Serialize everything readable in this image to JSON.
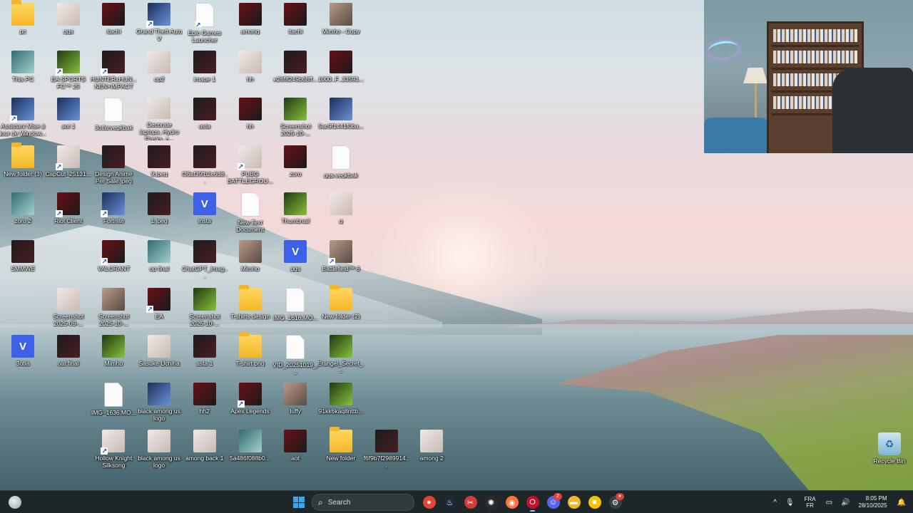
{
  "desktop": {
    "icons": [
      {
        "label": "pc",
        "kind": "folder",
        "col": 0,
        "row": 0
      },
      {
        "label": "ggs",
        "kind": "img-light",
        "col": 1,
        "row": 0
      },
      {
        "label": "itachi",
        "kind": "img-red",
        "col": 2,
        "row": 0
      },
      {
        "label": "Grand Theft Auto V",
        "kind": "img-blue",
        "col": 3,
        "row": 0,
        "shortcut": true
      },
      {
        "label": "Epic Games Launcher",
        "kind": "doc",
        "col": 4,
        "row": 0,
        "shortcut": true
      },
      {
        "label": "among",
        "kind": "img-red",
        "col": 5,
        "row": 0
      },
      {
        "label": "itachi",
        "kind": "img-red",
        "col": 6,
        "row": 0
      },
      {
        "label": "Mimho - Copy",
        "kind": "img-photo",
        "col": 7,
        "row": 0
      },
      {
        "label": "This PC",
        "kind": "img-teal",
        "col": 0,
        "row": 1
      },
      {
        "label": "EA SPORTS FC™ 25",
        "kind": "img-green",
        "col": 1,
        "row": 1,
        "shortcut": true
      },
      {
        "label": "HUNTERxHUN... NEN×IMPACT",
        "kind": "img-dark",
        "col": 2,
        "row": 1,
        "shortcut": true
      },
      {
        "label": "op2",
        "kind": "img-light",
        "col": 3,
        "row": 1
      },
      {
        "label": "image 1",
        "kind": "img-dark",
        "col": 4,
        "row": 1
      },
      {
        "label": "hh",
        "kind": "img-light",
        "col": 5,
        "row": 1
      },
      {
        "label": "e26f8249b68ff...",
        "kind": "img-dark",
        "col": 6,
        "row": 1
      },
      {
        "label": "1000_F_33591...",
        "kind": "img-red",
        "col": 7,
        "row": 1
      },
      {
        "label": "Assistant Mise à jour de Window...",
        "kind": "img-blue",
        "col": 0,
        "row": 2,
        "shortcut": true
      },
      {
        "label": "aot 1",
        "kind": "img-blue",
        "col": 1,
        "row": 2
      },
      {
        "label": "3otlarvegkbak",
        "kind": "doc",
        "col": 2,
        "row": 2
      },
      {
        "label": "Decorate laptops, Hydro Flasks, c...",
        "kind": "img-light",
        "col": 3,
        "row": 2
      },
      {
        "label": "asta",
        "kind": "img-dark",
        "col": 4,
        "row": 2
      },
      {
        "label": "hh",
        "kind": "img-red",
        "col": 5,
        "row": 2
      },
      {
        "label": "Screenshot 2025-10-...",
        "kind": "img-green",
        "col": 6,
        "row": 2
      },
      {
        "label": "5ac9f1441f0ba...",
        "kind": "img-blue",
        "col": 7,
        "row": 2
      },
      {
        "label": "New folder (3)",
        "kind": "folder",
        "col": 0,
        "row": 3
      },
      {
        "label": "CapCut_25131...",
        "kind": "img-light",
        "col": 1,
        "row": 3,
        "shortcut": true
      },
      {
        "label": "Design Anime Per Sale.jpeg",
        "kind": "img-dark",
        "col": 2,
        "row": 3
      },
      {
        "label": "9.jpeg",
        "kind": "img-dark",
        "col": 3,
        "row": 3
      },
      {
        "label": "f36af39fb2e6d8...",
        "kind": "img-dark",
        "col": 4,
        "row": 3
      },
      {
        "label": "PUBG BATTLEGROU...",
        "kind": "img-light",
        "col": 5,
        "row": 3,
        "shortcut": true
      },
      {
        "label": "zoro",
        "kind": "img-red",
        "col": 6,
        "row": 3
      },
      {
        "label": "ggs.vegkbak",
        "kind": "doc",
        "col": 7,
        "row": 3
      },
      {
        "label": "zoro 2",
        "kind": "img-teal",
        "col": 0,
        "row": 4
      },
      {
        "label": "Riot Client",
        "kind": "img-red",
        "col": 1,
        "row": 4,
        "shortcut": true
      },
      {
        "label": "Fortnite",
        "kind": "img-blue",
        "col": 2,
        "row": 4,
        "shortcut": true
      },
      {
        "label": "1.jpeg",
        "kind": "img-dark",
        "col": 3,
        "row": 4
      },
      {
        "label": "insta",
        "kind": "vapp",
        "col": 4,
        "row": 4
      },
      {
        "label": "New Text Document",
        "kind": "doc",
        "col": 5,
        "row": 4
      },
      {
        "label": "Thumbnail",
        "kind": "img-green",
        "col": 6,
        "row": 4
      },
      {
        "label": "g",
        "kind": "img-light",
        "col": 7,
        "row": 4
      },
      {
        "label": "SMMWE",
        "kind": "img-dark",
        "col": 0,
        "row": 5
      },
      {
        "label": "VALORANT",
        "kind": "img-red",
        "col": 2,
        "row": 5,
        "shortcut": true
      },
      {
        "label": "op final",
        "kind": "img-teal",
        "col": 3,
        "row": 5
      },
      {
        "label": "ChatGPT_Imag...",
        "kind": "img-dark",
        "col": 4,
        "row": 5
      },
      {
        "label": "Mimho",
        "kind": "img-photo",
        "col": 5,
        "row": 5
      },
      {
        "label": "ggs",
        "kind": "vapp",
        "col": 6,
        "row": 5
      },
      {
        "label": "Battlefield™ 6",
        "kind": "img-photo",
        "col": 7,
        "row": 5,
        "shortcut": true
      },
      {
        "label": "Screenshot 2025-09-...",
        "kind": "img-light",
        "col": 1,
        "row": 6
      },
      {
        "label": "Screenshot 2025-10-...",
        "kind": "img-photo",
        "col": 2,
        "row": 6
      },
      {
        "label": "EA",
        "kind": "img-red",
        "col": 3,
        "row": 6,
        "shortcut": true
      },
      {
        "label": "Screenshot 2025-10-...",
        "kind": "img-green",
        "col": 4,
        "row": 6
      },
      {
        "label": "T-shirts design",
        "kind": "folder",
        "col": 5,
        "row": 6
      },
      {
        "label": "IMG_1616.MO...",
        "kind": "doc",
        "col": 6,
        "row": 6
      },
      {
        "label": "New folder (2)",
        "kind": "folder",
        "col": 7,
        "row": 6
      },
      {
        "label": "3otla",
        "kind": "vapp",
        "col": 0,
        "row": 7
      },
      {
        "label": "oat final",
        "kind": "img-dark",
        "col": 1,
        "row": 7
      },
      {
        "label": "Mimho",
        "kind": "img-green",
        "col": 2,
        "row": 7
      },
      {
        "label": "Sasuke Uchiha",
        "kind": "img-light",
        "col": 3,
        "row": 7
      },
      {
        "label": "asta 1",
        "kind": "img-dark",
        "col": 4,
        "row": 7
      },
      {
        "label": "T-shirt png",
        "kind": "folder",
        "col": 5,
        "row": 7
      },
      {
        "label": "VID_20251019_...",
        "kind": "doc",
        "col": 6,
        "row": 7
      },
      {
        "label": "Erangel_Secret_...",
        "kind": "img-green",
        "col": 7,
        "row": 7
      },
      {
        "label": "IMG_1636.MO...",
        "kind": "doc",
        "col": 2,
        "row": 8
      },
      {
        "label": "black among us logo",
        "kind": "img-blue",
        "col": 3,
        "row": 8
      },
      {
        "label": "hh2",
        "kind": "img-red",
        "col": 4,
        "row": 8
      },
      {
        "label": "Apex Legends",
        "kind": "img-red",
        "col": 5,
        "row": 8,
        "shortcut": true
      },
      {
        "label": "luffy",
        "kind": "img-photo",
        "col": 6,
        "row": 8
      },
      {
        "label": "91kk6kaq8nttb...",
        "kind": "img-green",
        "col": 7,
        "row": 8
      },
      {
        "label": "Hollow Knight Silksong",
        "kind": "img-light",
        "col": 2,
        "row": 9,
        "shortcut": true
      },
      {
        "label": "black among us logo",
        "kind": "img-light",
        "col": 3,
        "row": 9
      },
      {
        "label": "among back 1",
        "kind": "img-light",
        "col": 4,
        "row": 9
      },
      {
        "label": "5a486f088b0...",
        "kind": "img-teal",
        "col": 5,
        "row": 9
      },
      {
        "label": "aot",
        "kind": "img-red",
        "col": 6,
        "row": 9
      },
      {
        "label": "New folder",
        "kind": "folder",
        "col": 7,
        "row": 9
      },
      {
        "label": "f6f9b7f2989914...",
        "kind": "img-dark",
        "col": 8,
        "row": 9
      },
      {
        "label": "among 2",
        "kind": "img-light",
        "col": 9,
        "row": 9
      }
    ],
    "recycle_bin": {
      "label": "Recycle Bin",
      "icon": "recycle-bin-icon"
    }
  },
  "taskbar": {
    "search_placeholder": "Search",
    "pinned": [
      {
        "name": "chrome",
        "color": "#e84235",
        "glyph": "●"
      },
      {
        "name": "steam",
        "color": "#1b2838",
        "glyph": "♨"
      },
      {
        "name": "snipping-tool",
        "color": "#d23a3a",
        "glyph": "✂"
      },
      {
        "name": "chatgpt",
        "color": "#2b2b2b",
        "glyph": "✺"
      },
      {
        "name": "firefox",
        "color": "#ff7139",
        "glyph": "◉"
      },
      {
        "name": "opera-gx",
        "color": "#c4122e",
        "glyph": "O",
        "active": true
      },
      {
        "name": "discord",
        "color": "#5865f2",
        "glyph": "☺",
        "badge": "2"
      },
      {
        "name": "file-explorer",
        "color": "#f4b629",
        "glyph": "▬"
      },
      {
        "name": "bandicam",
        "color": "#f7c200",
        "glyph": "■"
      },
      {
        "name": "settings",
        "color": "#3a3f42",
        "glyph": "⚙",
        "badge": "●"
      }
    ],
    "tray": {
      "chevron": "^",
      "lang_top": "FRA",
      "lang_bottom": "FR",
      "time": "8:05 PM",
      "date": "28/10/2025"
    }
  }
}
